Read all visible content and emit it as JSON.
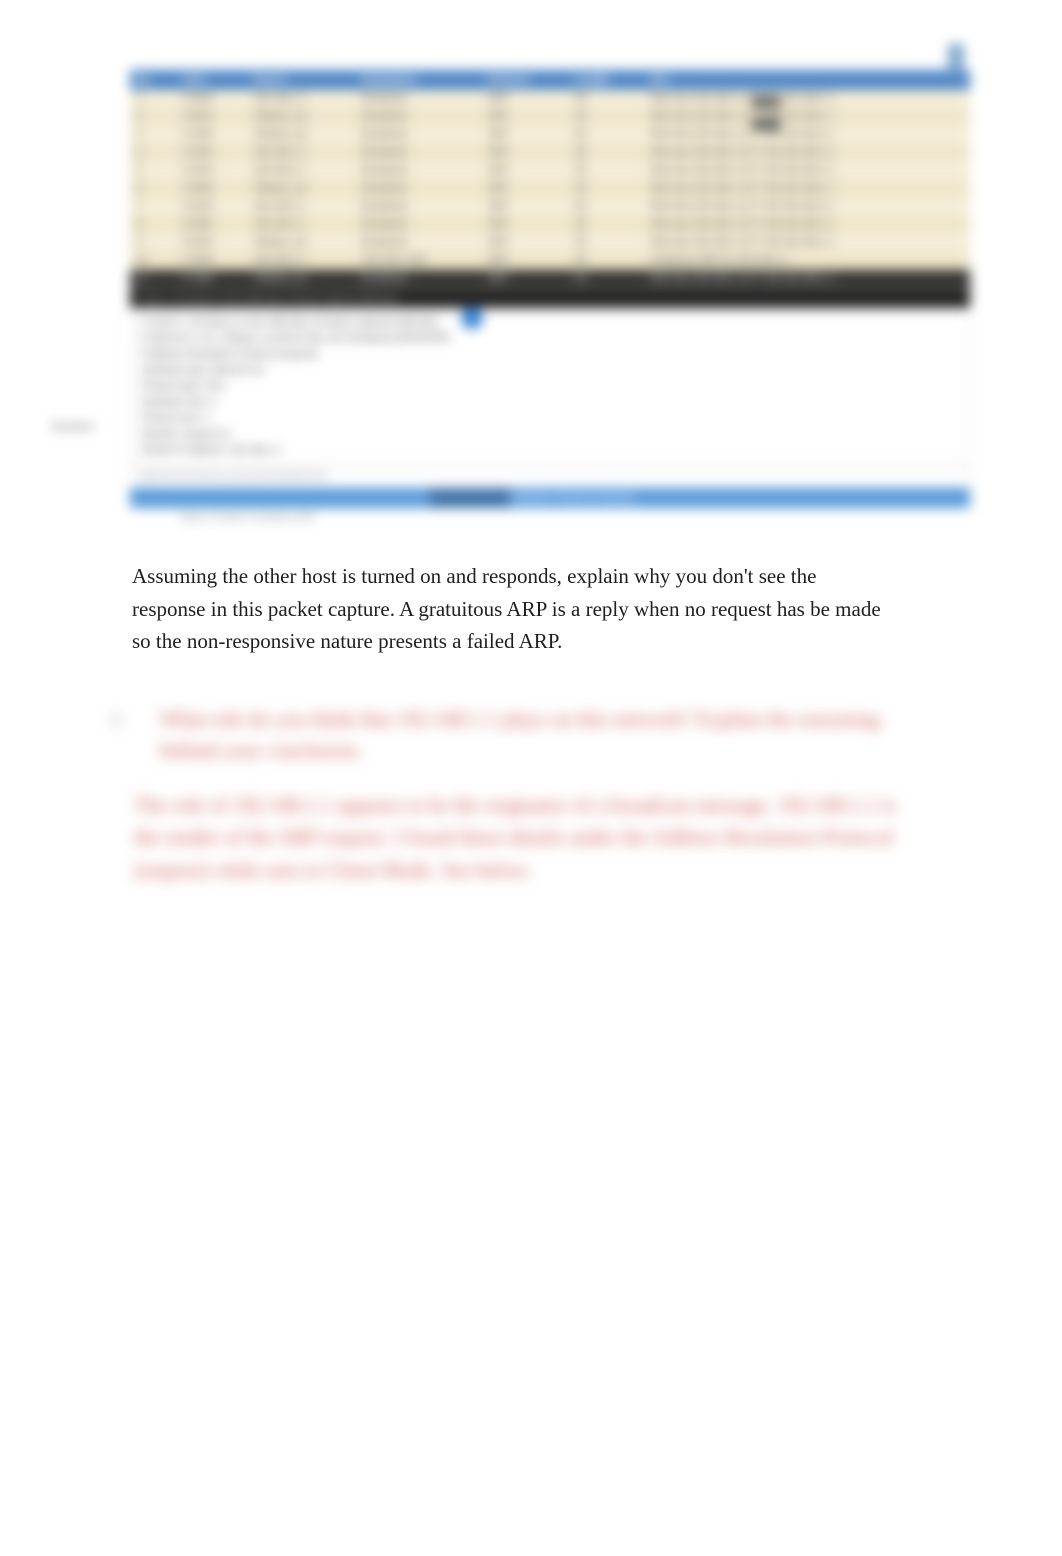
{
  "capture": {
    "columns": [
      "No.",
      "Time",
      "Source",
      "Destination",
      "Protocol",
      "Length",
      "Info"
    ],
    "badges": {
      "first": "100",
      "second": "200"
    },
    "rows": [
      {
        "no": "1",
        "time": "0.0000",
        "src": "192.168.1.1",
        "dst": "Broadcast",
        "proto": "ARP",
        "len": "60",
        "info": "Who has 192.168.1.117? Tell 192.168.1.1"
      },
      {
        "no": "2",
        "time": "0.0010",
        "src": "VMware_4a",
        "dst": "Broadcast",
        "proto": "ARP",
        "len": "60",
        "info": "Who has 192.168.1.117? Tell 192.168.1.1"
      },
      {
        "no": "3",
        "time": "0.1000",
        "src": "VMware_4a",
        "dst": "Broadcast",
        "proto": "ARP",
        "len": "60",
        "info": "Who has 192.168.1.117? Tell 192.168.1.1"
      },
      {
        "no": "4",
        "time": "0.1200",
        "src": "192.168.1.1",
        "dst": "Broadcast",
        "proto": "ARP",
        "len": "60",
        "info": "Who has 192.168.1.117? Tell 192.168.1.1"
      },
      {
        "no": "5",
        "time": "0.2100",
        "src": "192.168.1.1",
        "dst": "Broadcast",
        "proto": "ARP",
        "len": "60",
        "info": "Who has 192.168.1.117? Tell 192.168.1.1"
      },
      {
        "no": "6",
        "time": "0.3000",
        "src": "VMware_4a",
        "dst": "Broadcast",
        "proto": "ARP",
        "len": "60",
        "info": "Who has 192.168.1.117? Tell 192.168.1.1"
      },
      {
        "no": "7",
        "time": "0.4100",
        "src": "192.168.1.1",
        "dst": "Broadcast",
        "proto": "ARP",
        "len": "60",
        "info": "Who has 192.168.1.117? Tell 192.168.1.1"
      },
      {
        "no": "8",
        "time": "0.5000",
        "src": "192.168.1.1",
        "dst": "Broadcast",
        "proto": "ARP",
        "len": "60",
        "info": "Who has 192.168.1.117? Tell 192.168.1.1"
      },
      {
        "no": "9",
        "time": "0.6200",
        "src": "VMware_4a",
        "dst": "Broadcast",
        "proto": "ARP",
        "len": "60",
        "info": "Who has 192.168.1.117? Tell 192.168.1.1"
      },
      {
        "no": "10",
        "time": "0.7000",
        "src": "192.168.1.1",
        "dst": "192.168.1.255",
        "proto": "ARP",
        "len": "60",
        "info": "Gratuitous ARP for 192.168.1.1"
      },
      {
        "no": "11",
        "time": "0.7800",
        "src": "VMware_4a",
        "dst": "Broadcast",
        "proto": "ARP",
        "len": "60",
        "info": "Who has 192.168.1.117? Tell 192.168.1.1"
      }
    ],
    "detail_header": "Frame 1: 60 bytes on wire (480 bits), 60 bytes captured (480 bits)",
    "detail_lines": [
      "▸ Frame 1: 60 bytes on wire (480 bits), 60 bytes captured (480 bits)",
      "▸ Ethernet II, Src: VMware_4a (00:0c:29), Dst: Broadcast (ff:ff:ff:ff:ff:ff)",
      "▾ Address Resolution Protocol (request)",
      "    Hardware type: Ethernet (1)",
      "    Protocol type: IPv4",
      "    Hardware size: 6",
      "    Protocol size: 4",
      "    Opcode: request (1)",
      "    Sender IP address: 192.168.1.1"
    ],
    "left_label": "Answer",
    "hex_line": "0000   ff ff ff ff ff ff 00 0c 29 4a 00 00 08 06 00 01",
    "highlight_text": "Address Resolution Protocol (request)",
    "caption": "Figure 1  Packet 1  Gratuitous ARP"
  },
  "body_text": "Assuming the other host is turned on and responds, explain why you don't see the response in this packet capture. A gratuitous ARP is a reply when no request has be made so the non-responsive nature presents a failed ARP.",
  "qa": {
    "number": "4.",
    "question": "What role do you think that 192.168.1.1 plays on this network? Explain the reasoning behind your conclusion.",
    "answer": "The role of 192.168.1.1 appears to be the originator of a broadcast message. 192.168.1.1 is the sender of the ARP request. I found these details under the Address Resolution Protocol (request) while arm in Client Mode. See below."
  }
}
